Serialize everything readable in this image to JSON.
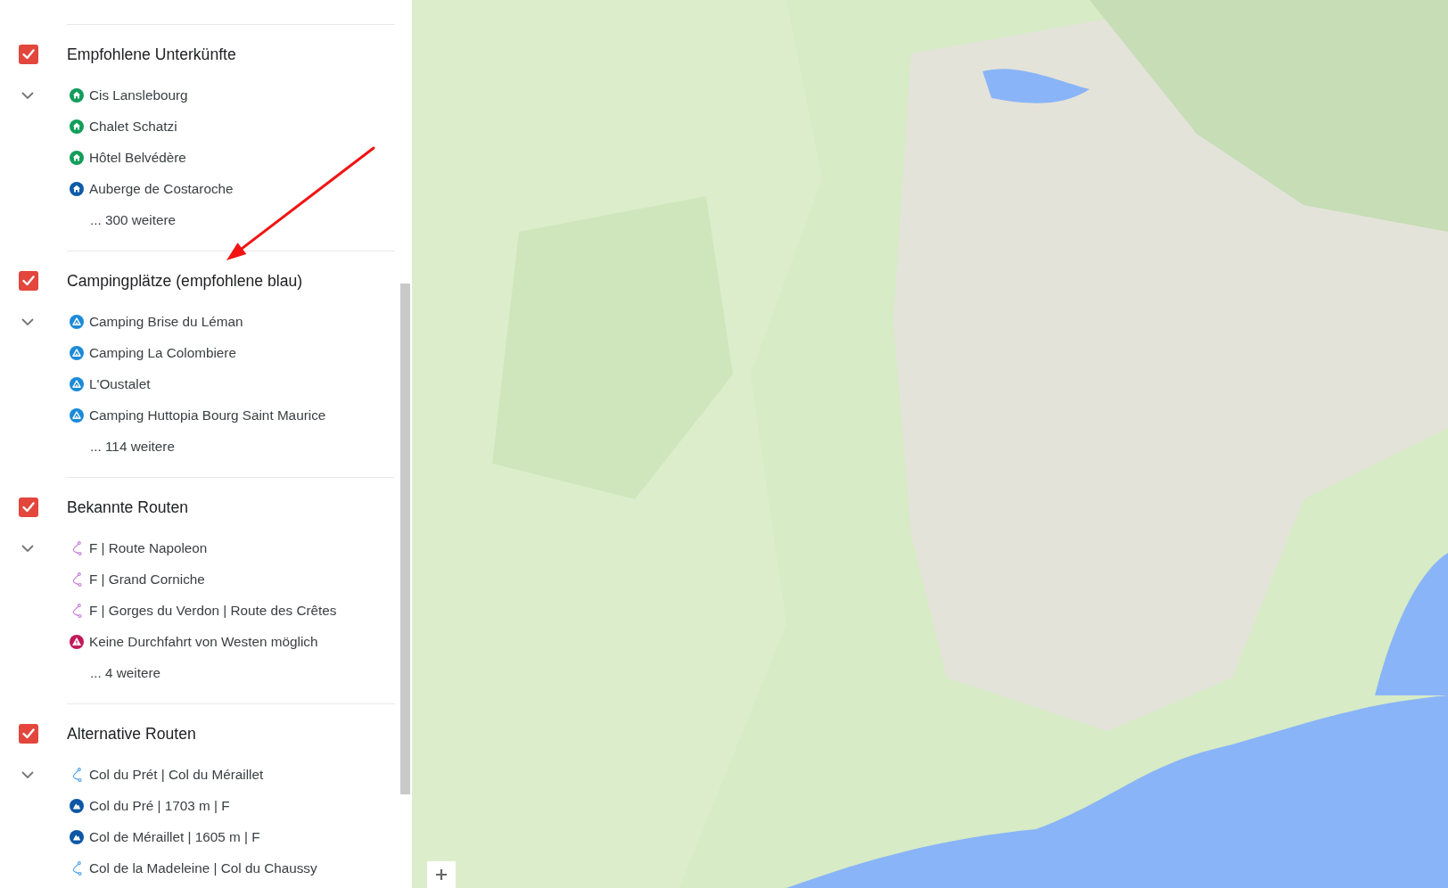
{
  "sections": [
    {
      "title": "Empfohlene Unterkünfte",
      "checked": true,
      "expanded": true,
      "items": [
        {
          "label": "Cis Lanslebourg",
          "kind": "house",
          "color": "#139d5b"
        },
        {
          "label": "Chalet Schatzi",
          "kind": "house",
          "color": "#139d5b"
        },
        {
          "label": "Hôtel Belvédère",
          "kind": "house",
          "color": "#139d5b"
        },
        {
          "label": "Auberge de Costaroche",
          "kind": "house",
          "color": "#0d5aa7"
        }
      ],
      "more": "... 300 weitere"
    },
    {
      "title": "Campingplätze (empfohlene blau)",
      "checked": true,
      "expanded": true,
      "items": [
        {
          "label": "Camping Brise du Léman",
          "kind": "tent",
          "color": "#1b8ad8"
        },
        {
          "label": "Camping La Colombiere",
          "kind": "tent",
          "color": "#1b8ad8"
        },
        {
          "label": "L'Oustalet",
          "kind": "tent",
          "color": "#1b8ad8"
        },
        {
          "label": "Camping Huttopia Bourg Saint Maurice",
          "kind": "tent",
          "color": "#1b8ad8"
        }
      ],
      "more": "... 114 weitere"
    },
    {
      "title": "Bekannte Routen",
      "checked": true,
      "expanded": true,
      "items": [
        {
          "label": "F | Route Napoleon",
          "kind": "route",
          "color": "#c47ad6"
        },
        {
          "label": "F | Grand Corniche",
          "kind": "route",
          "color": "#c47ad6"
        },
        {
          "label": "F | Gorges du Verdon | Route des Crêtes",
          "kind": "route",
          "color": "#c47ad6"
        },
        {
          "label": "Keine Durchfahrt von Westen möglich",
          "kind": "warning",
          "color": "#c2185b"
        }
      ],
      "more": "... 4 weitere"
    },
    {
      "title": "Alternative Routen",
      "checked": true,
      "expanded": true,
      "items": [
        {
          "label": "Col du Prét | Col du Méraillet",
          "kind": "route",
          "color": "#4a9fe6"
        },
        {
          "label": "Col du Pré | 1703 m | F",
          "kind": "mountain",
          "color": "#0d57a6"
        },
        {
          "label": "Col de Méraillet | 1605 m | F",
          "kind": "mountain",
          "color": "#0d57a6"
        },
        {
          "label": "Col de la Madeleine | Col du Chaussy",
          "kind": "route",
          "color": "#4a9fe6"
        }
      ]
    }
  ]
}
